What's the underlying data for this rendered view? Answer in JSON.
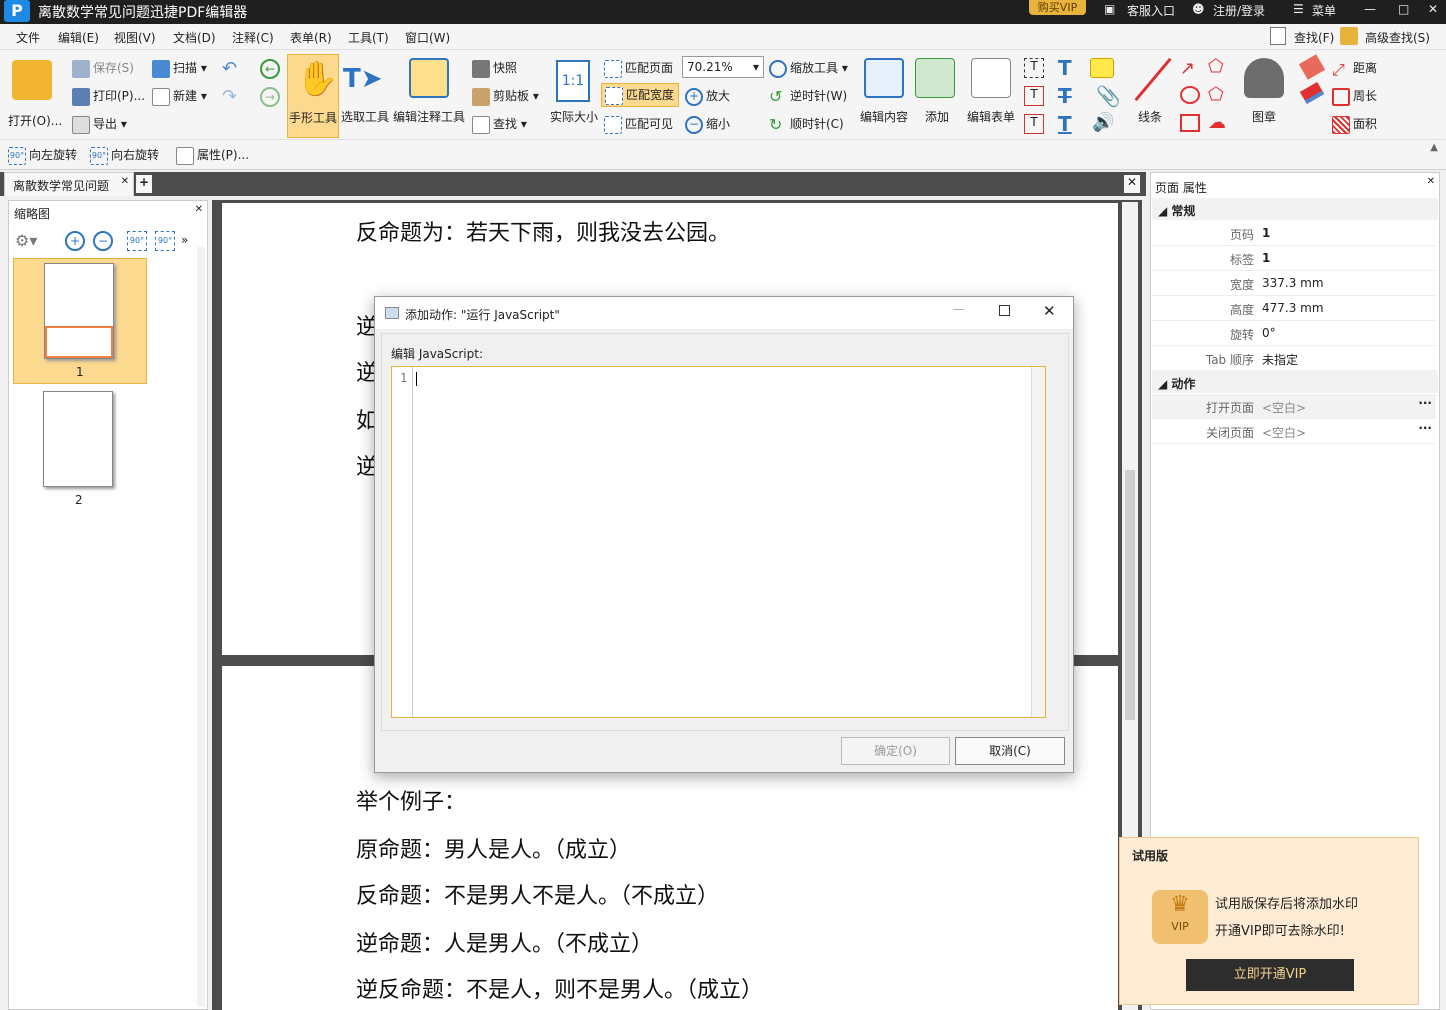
{
  "app": {
    "title": "离散数学常见问题迅捷PDF编辑器",
    "logo": "P",
    "vip": "购买VIP",
    "service": "客服入口",
    "login": "注册/登录",
    "menu": "菜单"
  },
  "menubar": [
    "文件",
    "编辑(E)",
    "视图(V)",
    "文档(D)",
    "注释(C)",
    "表单(R)",
    "工具(T)",
    "窗口(W)"
  ],
  "search": {
    "find": "查找(F)",
    "advanced": "高级查找(S)"
  },
  "ribbon": {
    "open": "打开(O)...",
    "save": "保存(S)",
    "print": "打印(P)...",
    "export": "导出",
    "scan": "扫描",
    "new": "新建",
    "hand": "手形工具",
    "select": "选取工具",
    "edit_annot": "编辑注释工具",
    "snapshot": "快照",
    "clipboard": "剪贴板",
    "find": "查找",
    "actual": "实际大小",
    "fit_page": "匹配页面",
    "fit_width": "匹配宽度",
    "fit_visible": "匹配可见",
    "zoom": "70.21%",
    "zoom_tool": "缩放工具",
    "zoom_in": "放大",
    "zoom_out": "缩小",
    "ccw": "逆时针(W)",
    "cw": "顺时针(C)",
    "edit_content": "编辑内容",
    "add": "添加",
    "edit_form": "编辑表单",
    "line": "线条",
    "stamp": "图章",
    "distance": "距离",
    "perimeter": "周长",
    "area": "面积"
  },
  "subbar": {
    "rotate_left": "向左旋转",
    "rotate_right": "向右旋转",
    "properties": "属性(P)..."
  },
  "doc_tab": "离散数学常见问题",
  "thumbs": {
    "title": "缩略图",
    "pages": [
      "1",
      "2"
    ]
  },
  "page1_lines": [
    "反命题为：若天下雨，则我没去公园。",
    "逆",
    "逆",
    "如",
    "逆"
  ],
  "page2_lines": [
    "举个例子：",
    "原命题：男人是人。（成立）",
    "反命题：不是男人不是人。（不成立）",
    "逆命题：人是男人。（不成立）",
    "逆反命题：不是人，则不是男人。（成立）"
  ],
  "props": {
    "title": "页面 属性",
    "sec_general": "常规",
    "rows": [
      {
        "label": "页码",
        "value": "1"
      },
      {
        "label": "标签",
        "value": "1"
      },
      {
        "label": "宽度",
        "value": "337.3 mm"
      },
      {
        "label": "高度",
        "value": "477.3 mm"
      },
      {
        "label": "旋转",
        "value": "0°"
      },
      {
        "label": "Tab 顺序",
        "value": "未指定"
      }
    ],
    "sec_action": "动作",
    "actions": [
      {
        "label": "打开页面",
        "value": "<空白>"
      },
      {
        "label": "关闭页面",
        "value": "<空白>"
      }
    ]
  },
  "dialog": {
    "title": "添加动作: \"运行 JavaScript\"",
    "label": "编辑 JavaScript:",
    "line_no": "1",
    "ok": "确定(O)",
    "cancel": "取消(C)"
  },
  "promo": {
    "title": "试用版",
    "line1": "试用版保存后将添加水印",
    "line2": "开通VIP即可去除水印!",
    "button": "立即开通VIP",
    "badge": "VIP"
  }
}
